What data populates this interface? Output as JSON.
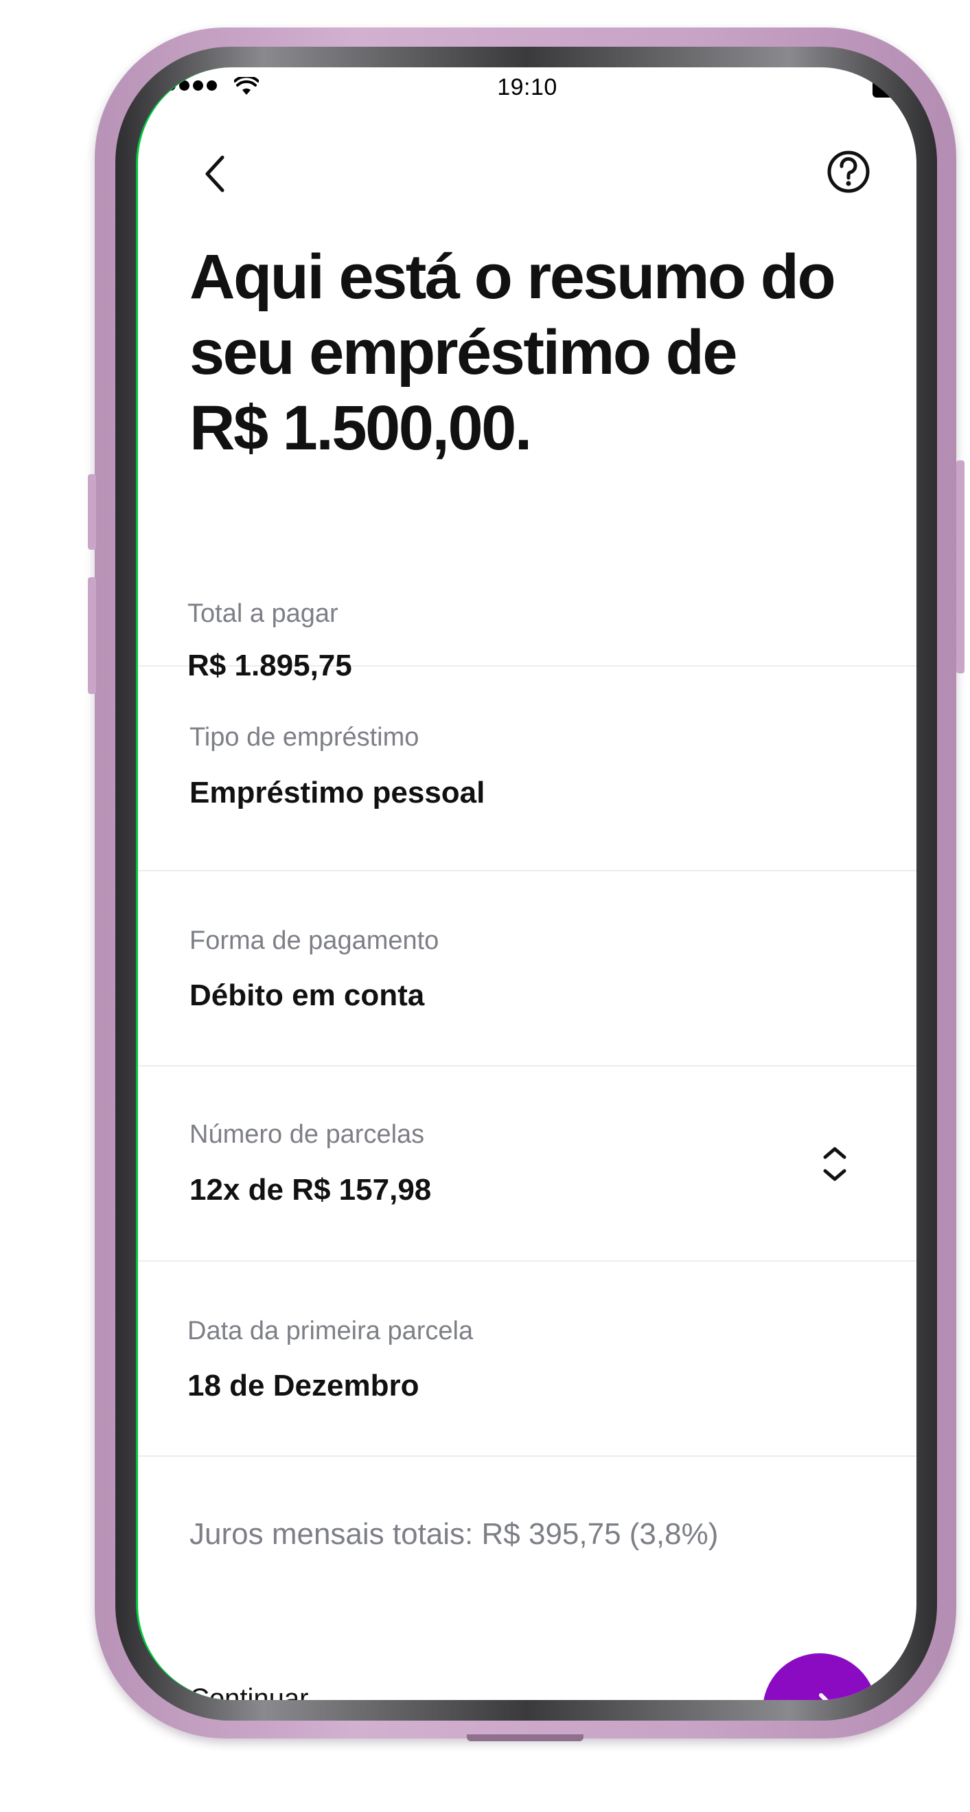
{
  "status_bar": {
    "time": "19:10"
  },
  "nav": {
    "back_icon": "chevron-left-icon",
    "help_icon": "question-circle-icon"
  },
  "headline": "Aqui está o resumo do\nseu empréstimo de\nR$ 1.500,00.",
  "summary": [
    {
      "label": "Total a pagar",
      "value": "R$ 1.895,75"
    },
    {
      "label": "Tipo de empréstimo",
      "value": "Empréstimo pessoal"
    },
    {
      "label": "Forma de pagamento",
      "value": "Débito em conta"
    },
    {
      "label": "Número de parcelas",
      "value": "12x de R$ 157,98",
      "icon": "chevron-up-down-icon"
    },
    {
      "label": "Data da primeira parcela",
      "value": "18 de Dezembro"
    }
  ],
  "rates": {
    "monthly_interest": "Juros mensais totais: R$ 395,75 (3,8%)"
  },
  "footer": {
    "continue_label": "Continuar",
    "continue_icon": "arrow-right-icon"
  },
  "colors": {
    "accent": "#8b0bc3",
    "frame": "#c7a3c5",
    "label_gray": "#7d7f87",
    "text": "#111111"
  }
}
